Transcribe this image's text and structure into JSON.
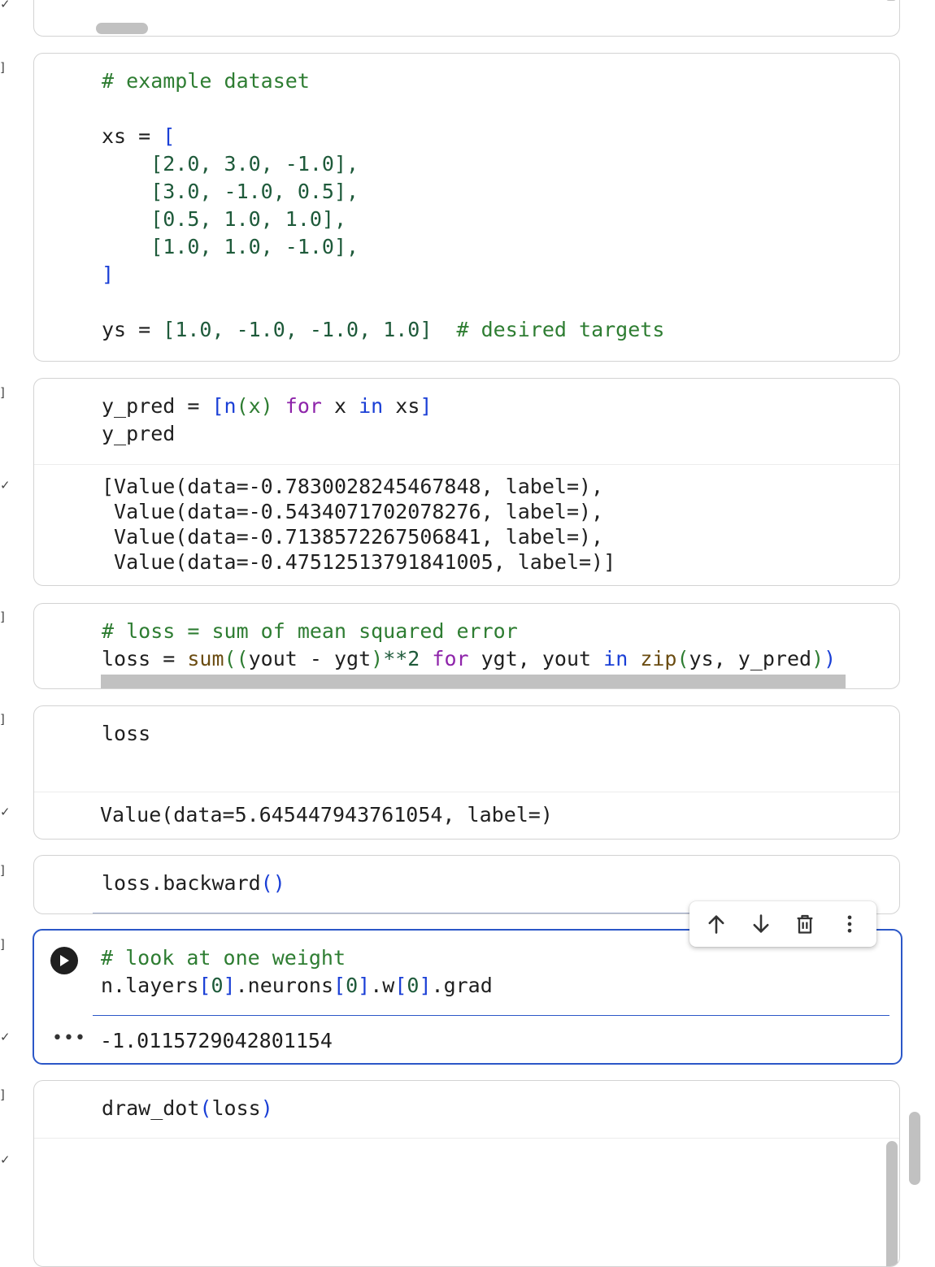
{
  "gutter": {
    "bracket": "]",
    "check": "✓"
  },
  "cells": {
    "dataset": {
      "comment": "# example dataset",
      "xs_open": "xs = ",
      "xs_bracket_open": "[",
      "rows": [
        "[2.0, 3.0, -1.0],",
        "[3.0, -1.0, 0.5],",
        "[0.5, 1.0, 1.0],",
        "[1.0, 1.0, -1.0],"
      ],
      "xs_bracket_close": "]",
      "ys_line_start": "ys = ",
      "ys_values": "[1.0, -1.0, -1.0, 1.0]",
      "ys_comment": "  # desired targets"
    },
    "pred": {
      "line1_a": "y_pred = ",
      "line1_b": "[n",
      "line1_c": "(x) ",
      "line1_for": "for",
      "line1_d": " x ",
      "line1_in": "in",
      "line1_e": " xs",
      "line1_f": "]",
      "line2": "y_pred",
      "output": [
        "[Value(data=-0.7830028245467848, label=),",
        " Value(data=-0.5434071702078276, label=),",
        " Value(data=-0.7138572267506841, label=),",
        " Value(data=-0.47512513791841005, label=)]"
      ]
    },
    "loss_def": {
      "comment": "# loss = sum of mean squared error",
      "p1": "loss = ",
      "sum": "sum",
      "p2": "((",
      "p3": "yout - ygt",
      "p4": ")",
      "p5": "**2 ",
      "for": "for",
      "p6": " ygt, yout ",
      "in": "in",
      "p7": " ",
      "zip": "zip",
      "p8": "(",
      "p9": "ys, y_pred",
      "p10": ")",
      "p11": ")"
    },
    "loss_show": {
      "code": "loss",
      "output": "Value(data=5.645447943761054, label=)"
    },
    "backward": {
      "a": "loss.backward",
      "b": "()"
    },
    "weight": {
      "comment": "# look at one weight",
      "a": "n.layers",
      "b": "[",
      "c": "0",
      "d": "]",
      "e": ".neurons",
      "f": "[",
      "g": "0",
      "h": "]",
      "i": ".w",
      "j": "[",
      "k": "0",
      "l": "]",
      "m": ".grad",
      "output": "-1.0115729042801154",
      "more": "•••"
    },
    "draw": {
      "a": "draw_dot",
      "b": "(",
      "c": "loss",
      "d": ")"
    }
  },
  "colors": {
    "comment": "#2e7d32",
    "keyword": "#8e24aa",
    "bracket": "#1a3fd6",
    "active_border": "#2b57c8"
  },
  "toolbar": {
    "icons": [
      "arrow-up-icon",
      "arrow-down-icon",
      "trash-icon",
      "more-vert-icon"
    ]
  }
}
